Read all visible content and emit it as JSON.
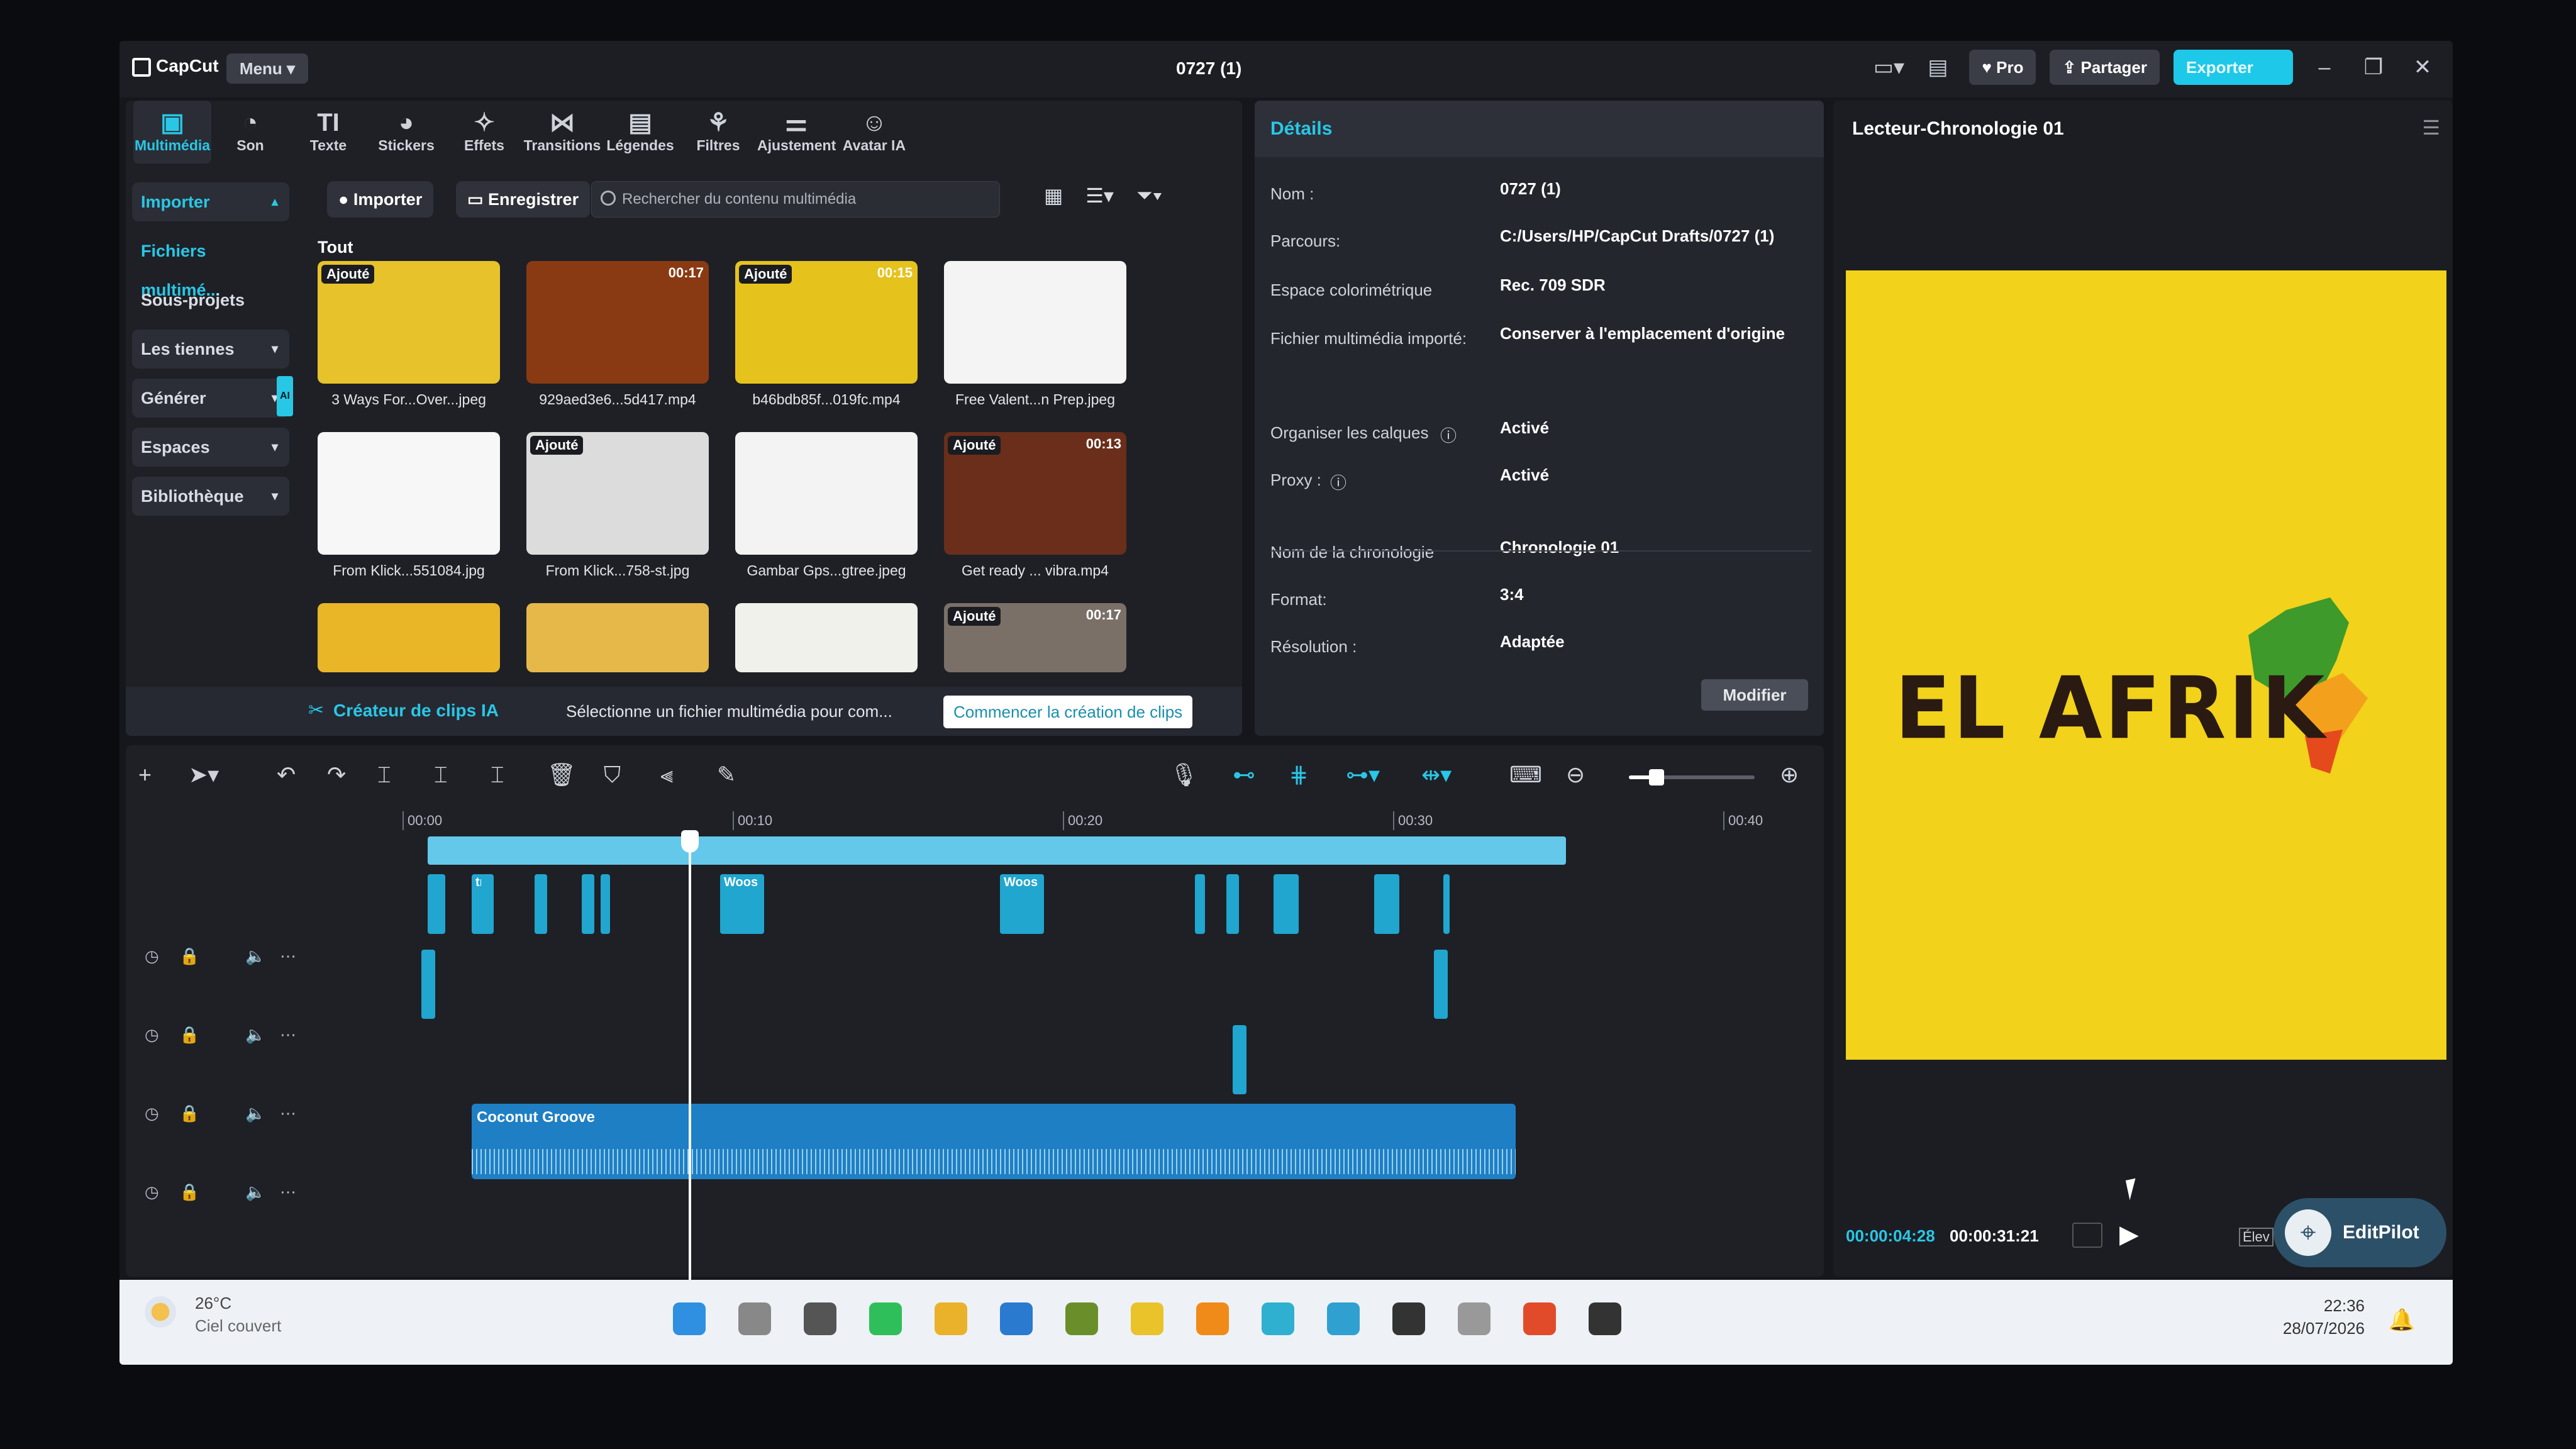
{
  "app": {
    "name": "CapCut",
    "menu_label": "Menu",
    "project_title": "0727 (1)",
    "pro_label": "Pro",
    "share_label": "Partager",
    "export_label": "Exporter"
  },
  "media_tabs": [
    {
      "label": "Multimédia",
      "icon": "media-icon",
      "glyph": "▣"
    },
    {
      "label": "Son",
      "icon": "audio-icon",
      "glyph": "◔"
    },
    {
      "label": "Texte",
      "icon": "text-icon",
      "glyph": "TI"
    },
    {
      "label": "Stickers",
      "icon": "sticker-icon",
      "glyph": "◕"
    },
    {
      "label": "Effets",
      "icon": "effects-icon",
      "glyph": "✧"
    },
    {
      "label": "Transitions",
      "icon": "transitions-icon",
      "glyph": "⋈"
    },
    {
      "label": "Légendes",
      "icon": "captions-icon",
      "glyph": "▤"
    },
    {
      "label": "Filtres",
      "icon": "filters-icon",
      "glyph": "⚘"
    },
    {
      "label": "Ajustement",
      "icon": "adjust-icon",
      "glyph": "⚌"
    },
    {
      "label": "Avatar IA",
      "icon": "avatar-icon",
      "glyph": "☺"
    }
  ],
  "sidebar": {
    "items": [
      {
        "label": "Importer"
      },
      {
        "label": "Fichiers multimé..."
      },
      {
        "label": "Sous-projets"
      },
      {
        "label": "Les tiennes"
      },
      {
        "label": "Générer",
        "badge": "AI"
      },
      {
        "label": "Espaces"
      },
      {
        "label": "Bibliothèque"
      }
    ]
  },
  "media_toolbar": {
    "import_label": "Importer",
    "record_label": "Enregistrer",
    "search_placeholder": "Rechercher du contenu multimédia",
    "filter_all": "Tout"
  },
  "media_items": [
    {
      "name": "3 Ways For...Over...jpeg",
      "badge": "Ajouté",
      "duration": "",
      "color": "#e8c22a"
    },
    {
      "name": "929aed3e6...5d417.mp4",
      "badge": "",
      "duration": "00:17",
      "color": "#8a3a12"
    },
    {
      "name": "b46bdb85f...019fc.mp4",
      "badge": "Ajouté",
      "duration": "00:15",
      "color": "#e6c21d"
    },
    {
      "name": "Free Valent...n Prep.jpeg",
      "badge": "",
      "duration": "",
      "color": "#f4f4f4"
    },
    {
      "name": "From Klick...551084.jpg",
      "badge": "",
      "duration": "",
      "color": "#f7f7f7"
    },
    {
      "name": "From Klick...758-st.jpg",
      "badge": "Ajouté",
      "duration": "",
      "color": "#dcdcdc"
    },
    {
      "name": "Gambar Gps...gtree.jpeg",
      "badge": "",
      "duration": "",
      "color": "#f3f3f3"
    },
    {
      "name": "Get ready ... vibra.mp4",
      "badge": "Ajouté",
      "duration": "00:13",
      "color": "#6a2e1a"
    },
    {
      "name": "",
      "badge": "",
      "duration": "",
      "color": "#e9b628"
    },
    {
      "name": "",
      "badge": "",
      "duration": "",
      "color": "#e6b84a"
    },
    {
      "name": "",
      "badge": "",
      "duration": "",
      "color": "#f1f1ec"
    },
    {
      "name": "",
      "badge": "Ajouté",
      "duration": "00:17",
      "color": "#7a7068"
    }
  ],
  "ai_clips": {
    "title": "Créateur de clips IA",
    "description": "Sélectionne un fichier multimédia pour com...",
    "button": "Commencer la création de clips"
  },
  "details": {
    "header": "Détails",
    "rows": [
      {
        "label": "Nom :",
        "value": "0727 (1)"
      },
      {
        "label": "Parcours:",
        "value": "C:/Users/HP/CapCut Drafts/0727 (1)"
      },
      {
        "label": "Espace colorimétrique",
        "value": "Rec. 709 SDR"
      },
      {
        "label": "Fichier multimédia importé:",
        "value": "Conserver à l'emplacement d'origine"
      },
      {
        "label": "Organiser les calques",
        "value": "Activé"
      },
      {
        "label": "Proxy :",
        "value": "Activé"
      },
      {
        "label": "Nom de la chronologie",
        "value": "Chronologie 01"
      },
      {
        "label": "Format:",
        "value": "3:4"
      },
      {
        "label": "Résolution :",
        "value": "Adaptée"
      }
    ],
    "modify_label": "Modifier"
  },
  "player": {
    "title": "Lecteur-Chronologie 01",
    "overlay_text": "EL AFRIK",
    "current_time": "00:00:04:28",
    "total_time": "00:00:31:21",
    "ratio_label": "Élev",
    "editpilot_label": "EditPilot"
  },
  "timeline": {
    "ruler": [
      "00:00",
      "00:10",
      "00:20",
      "00:30",
      "00:40"
    ],
    "zoom_level": 0.2,
    "playhead_time": "00:04",
    "clip_labels": [
      "tra",
      "Woos",
      "Woos"
    ],
    "audio_clip": "Coconut Groove"
  },
  "taskbar": {
    "temperature": "26°C",
    "weather": "Ciel couvert",
    "time": "22:36",
    "date": "28/07/2026"
  }
}
